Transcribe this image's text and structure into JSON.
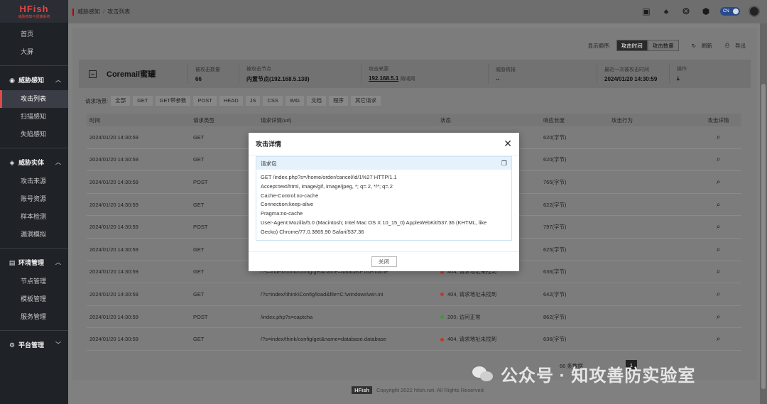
{
  "logo": {
    "title": "HFish",
    "subtitle": "威胁感知与诱捕系统"
  },
  "sidebar": {
    "items": [
      {
        "label": "首页"
      },
      {
        "label": "大屏"
      }
    ],
    "groups": [
      {
        "label": "威胁感知",
        "icon": "eye-icon",
        "items": [
          "攻击列表",
          "扫描感知",
          "失陷感知"
        ]
      },
      {
        "label": "威胁实体",
        "icon": "entity-icon",
        "items": [
          "攻击来源",
          "账号资源",
          "样本检测",
          "漏洞模拟"
        ]
      },
      {
        "label": "环境管理",
        "icon": "server-icon",
        "items": [
          "节点管理",
          "模板管理",
          "服务管理"
        ]
      },
      {
        "label": "平台管理",
        "icon": "gear-icon",
        "items": []
      }
    ]
  },
  "breadcrumb": {
    "parent": "威胁感知",
    "sep": "/",
    "current": "攻击列表"
  },
  "topbar": {
    "lang": "CN"
  },
  "toolbar": {
    "order_label": "显示顺序:",
    "order_time": "攻击时间",
    "order_count": "攻击数量",
    "refresh": "刷新",
    "export": "导出"
  },
  "summary": {
    "title": "Coremail蜜罐",
    "cols": [
      {
        "label": "被攻击数量",
        "value": "66"
      },
      {
        "label": "被攻击节点",
        "value": "内置节点(192.168.5.138)"
      },
      {
        "label": "攻击来源",
        "value": "192.168.5.1",
        "extra": "局域网"
      },
      {
        "label": "威胁情报",
        "value": "--"
      },
      {
        "label": "最近一次被攻击时间",
        "value": "2024/01/20 14:30:59"
      },
      {
        "label": "操作",
        "value": ""
      }
    ]
  },
  "filters": {
    "label": "请求场景:",
    "chips": [
      "全部",
      "GET",
      "GET带参数",
      "POST",
      "HEAD",
      "JS",
      "CSS",
      "IMG",
      "文档",
      "程序",
      "其它请求"
    ]
  },
  "table": {
    "headers": [
      "时间",
      "请求类型",
      "请求详情(url)",
      "状态",
      "响应长度",
      "攻击行为",
      "攻击详情"
    ],
    "rows": [
      {
        "time": "2024/01/20 14:30:59",
        "type": "GET",
        "url": "",
        "status": "",
        "status_color": "",
        "length": "620(字节)"
      },
      {
        "time": "2024/01/20 14:30:59",
        "type": "GET",
        "url": "",
        "status": "",
        "status_color": "",
        "length": "620(字节)"
      },
      {
        "time": "2024/01/20 14:30:59",
        "type": "POST",
        "url": "",
        "status": "",
        "status_color": "",
        "length": "765(字节)"
      },
      {
        "time": "2024/01/20 14:30:59",
        "type": "GET",
        "url": "",
        "status": "",
        "status_color": "",
        "length": "622(字节)"
      },
      {
        "time": "2024/01/20 14:30:59",
        "type": "POST",
        "url": "",
        "status": "",
        "status_color": "",
        "length": "797(字节)"
      },
      {
        "time": "2024/01/20 14:30:59",
        "type": "GET",
        "url": "",
        "status": "",
        "status_color": "",
        "length": "625(字节)"
      },
      {
        "time": "2024/01/20 14:30:59",
        "type": "GET",
        "url": "/?s=index/think/config/get&name=database.username",
        "status": "404, 请求地址未找到",
        "status_color": "#c0392b",
        "length": "636(字节)"
      },
      {
        "time": "2024/01/20 14:30:59",
        "type": "GET",
        "url": "/?s=index/\\think\\Config/load&file=C:\\windows\\win.ini",
        "status": "404, 请求地址未找到",
        "status_color": "#c0392b",
        "length": "642(字节)"
      },
      {
        "time": "2024/01/20 14:30:59",
        "type": "POST",
        "url": "/index.php?s=captcha",
        "status": "200, 访问正常",
        "status_color": "#3a9a3a",
        "length": "862(字节)"
      },
      {
        "time": "2024/01/20 14:30:59",
        "type": "GET",
        "url": "/?s=index/think/config/get&name=database.database",
        "status": "404, 请求地址未找到",
        "status_color": "#c0392b",
        "length": "636(字节)"
      }
    ]
  },
  "pager": {
    "total": "66 条数据",
    "current": "1"
  },
  "footer": {
    "badge": "HFish",
    "text": "Copyright 2022 hfish.net. All Rights Reserved"
  },
  "watermark": {
    "text": "公众号 · 知攻善防实验室"
  },
  "modal": {
    "title": "攻击详情",
    "section": "请求包",
    "lines": [
      "GET /index.php?s=/home/order/cancel/id/1%27 HTTP/1.1",
      "Accept:text/html, image/gif, image/jpeg, *; q=.2, */*; q=.2",
      "Cache-Control:no-cache",
      "Connection:keep-alive",
      "Pragma:no-cache",
      "User-Agent:Mozilla/5.0 (Macintosh; Intel Mac OS X 10_15_0) AppleWebKit/537.36 (KHTML, like",
      "Gecko) Chrome/77.0.3865.90 Safari/537.36"
    ],
    "close_label": "关闭"
  }
}
